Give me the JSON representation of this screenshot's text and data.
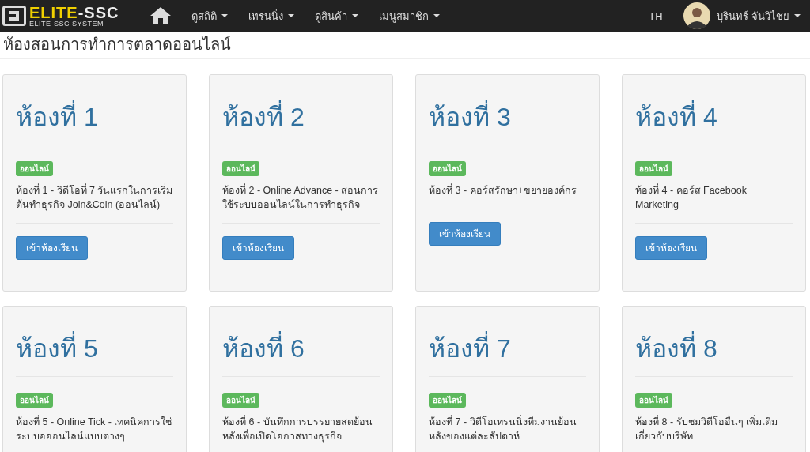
{
  "navbar": {
    "logo": {
      "name_first": "ELITE",
      "name_rest": "-SSC",
      "tagline": "ELITE-SSC SYSTEM"
    },
    "menu": [
      {
        "label": "ดูสถิติ",
        "dropdown": true
      },
      {
        "label": "เทรนนิ่ง",
        "dropdown": true
      },
      {
        "label": "ดูสินค้า",
        "dropdown": true
      },
      {
        "label": "เมนูสมาชิก",
        "dropdown": true
      }
    ],
    "language": "TH",
    "user": {
      "name": "บุรินทร์ จันวิไชย",
      "dropdown": true
    }
  },
  "page_title": "ห้องสอนการทำการตลาดออนไลน์",
  "rooms": [
    {
      "title": "ห้องที่ 1",
      "status": "ออนไลน์",
      "description": "ห้องที่ 1 - วิดีโอที่ 7 วันแรกในการเริ่มต้นทำธุรกิจ Join&Coin (ออนไลน์)",
      "button": "เข้าห้องเรียน"
    },
    {
      "title": "ห้องที่ 2",
      "status": "ออนไลน์",
      "description": "ห้องที่ 2 - Online Advance - สอนการใช้ระบบออนไลน์ในการทำธุรกิจ",
      "button": "เข้าห้องเรียน"
    },
    {
      "title": "ห้องที่ 3",
      "status": "ออนไลน์",
      "description": "ห้องที่ 3 - คอร์สรักษา+ขยายองค์กร",
      "button": "เข้าห้องเรียน"
    },
    {
      "title": "ห้องที่ 4",
      "status": "ออนไลน์",
      "description": "ห้องที่ 4 - คอร์ส Facebook Marketing",
      "button": "เข้าห้องเรียน"
    },
    {
      "title": "ห้องที่ 5",
      "status": "ออนไลน์",
      "description": "ห้องที่ 5 - Online Tick - เทคนิคการใช่ระบบอออนไลน์แบบต่างๆ"
    },
    {
      "title": "ห้องที่ 6",
      "status": "ออนไลน์",
      "description": "ห้องที่ 6 - บันทึกการบรรยายสดย้อนหลังเพื่อเปิดโอกาสทางธุรกิจ"
    },
    {
      "title": "ห้องที่ 7",
      "status": "ออนไลน์",
      "description": "ห้องที่ 7 - วิดีโอเทรนนิ่งทีมงานย้อนหลังของแต่ละสัปดาห์"
    },
    {
      "title": "ห้องที่ 8",
      "status": "ออนไลน์",
      "description": "ห้องที่ 8 - รับชมวิดีโออื่นๆ เพิ่มเติมเกี่ยวกับบริษัท"
    }
  ]
}
